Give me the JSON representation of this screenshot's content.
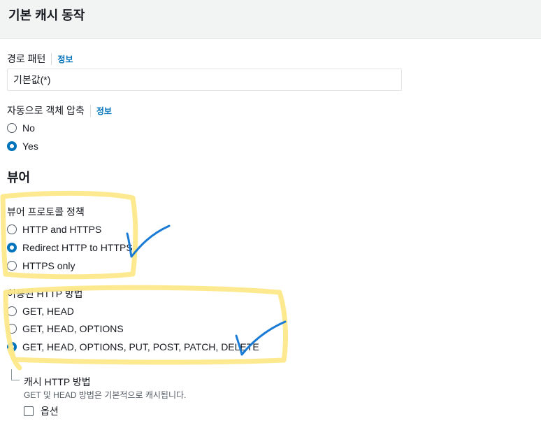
{
  "header": {
    "title": "기본 캐시 동작"
  },
  "path_pattern": {
    "label": "경로 패턴",
    "info": "정보",
    "value": "기본값(*)"
  },
  "compress": {
    "label": "자동으로 객체 압축",
    "info": "정보",
    "options": [
      {
        "label": "No",
        "checked": false
      },
      {
        "label": "Yes",
        "checked": true
      }
    ]
  },
  "viewer": {
    "title": "뷰어",
    "protocol_policy": {
      "label": "뷰어 프로토콜 정책",
      "options": [
        {
          "label": "HTTP and HTTPS",
          "checked": false
        },
        {
          "label": "Redirect HTTP to HTTPS",
          "checked": true
        },
        {
          "label": "HTTPS only",
          "checked": false
        }
      ]
    },
    "allowed_methods": {
      "label": "허용된 HTTP 방법",
      "options": [
        {
          "label": "GET, HEAD",
          "checked": false
        },
        {
          "label": "GET, HEAD, OPTIONS",
          "checked": false
        },
        {
          "label": "GET, HEAD, OPTIONS, PUT, POST, PATCH, DELETE",
          "checked": true
        }
      ]
    },
    "cache_methods": {
      "title": "캐시 HTTP 방법",
      "description": "GET 및 HEAD 방법은 기본적으로 캐시됩니다.",
      "option_label": "옵션",
      "option_checked": false
    }
  },
  "colors": {
    "accent": "#0073bb",
    "highlight": "#fde98a",
    "annotation": "#1a7bd6"
  }
}
